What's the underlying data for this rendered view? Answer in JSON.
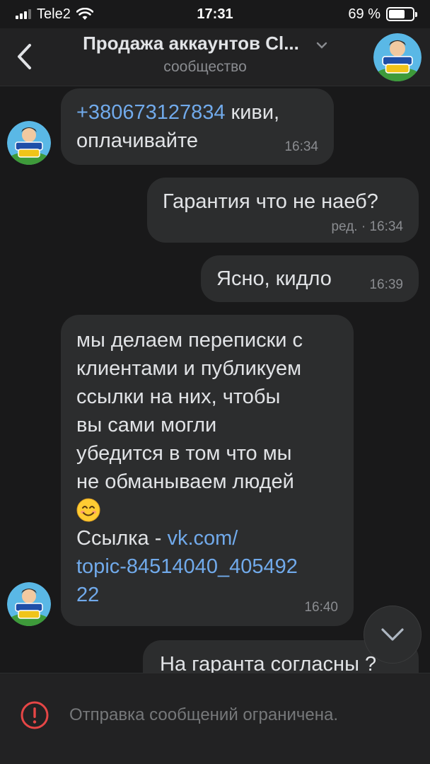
{
  "status_bar": {
    "carrier": "Tele2",
    "time": "17:31",
    "battery": "69 %",
    "battery_level": 0.69
  },
  "header": {
    "title": "Продажа аккаунтов Cl...",
    "subtitle": "сообщество",
    "avatar_text": "clash MIX"
  },
  "messages": [
    {
      "link": "+380673127834",
      "text_line1": " киви,",
      "text_line2": "оплачивайте",
      "time": "16:34"
    },
    {
      "text": "Гарантия что не наеб?",
      "meta": "ред. · 16:34"
    },
    {
      "text": "Ясно, кидло",
      "time": "16:39"
    },
    {
      "lines": [
        "мы делаем переписки с",
        "клиентами и публикуем",
        "ссылки на них, чтобы",
        "вы сами могли",
        "убедится в том что мы",
        "не обманываем людей"
      ],
      "emoji": "😊",
      "link_prefix": "Ссылка - ",
      "link_line1": "vk.com/",
      "link_line2": "topic-84514040_405492",
      "link_line3": "22",
      "time": "16:40"
    },
    {
      "text": "На гаранта согласны ?"
    }
  ],
  "bottom": {
    "restriction_text": "Отправка сообщений ограничена."
  },
  "colors": {
    "background": "#19191a",
    "bubble": "#2c2d2e",
    "link": "#71aaeb",
    "warning": "#e64646"
  }
}
